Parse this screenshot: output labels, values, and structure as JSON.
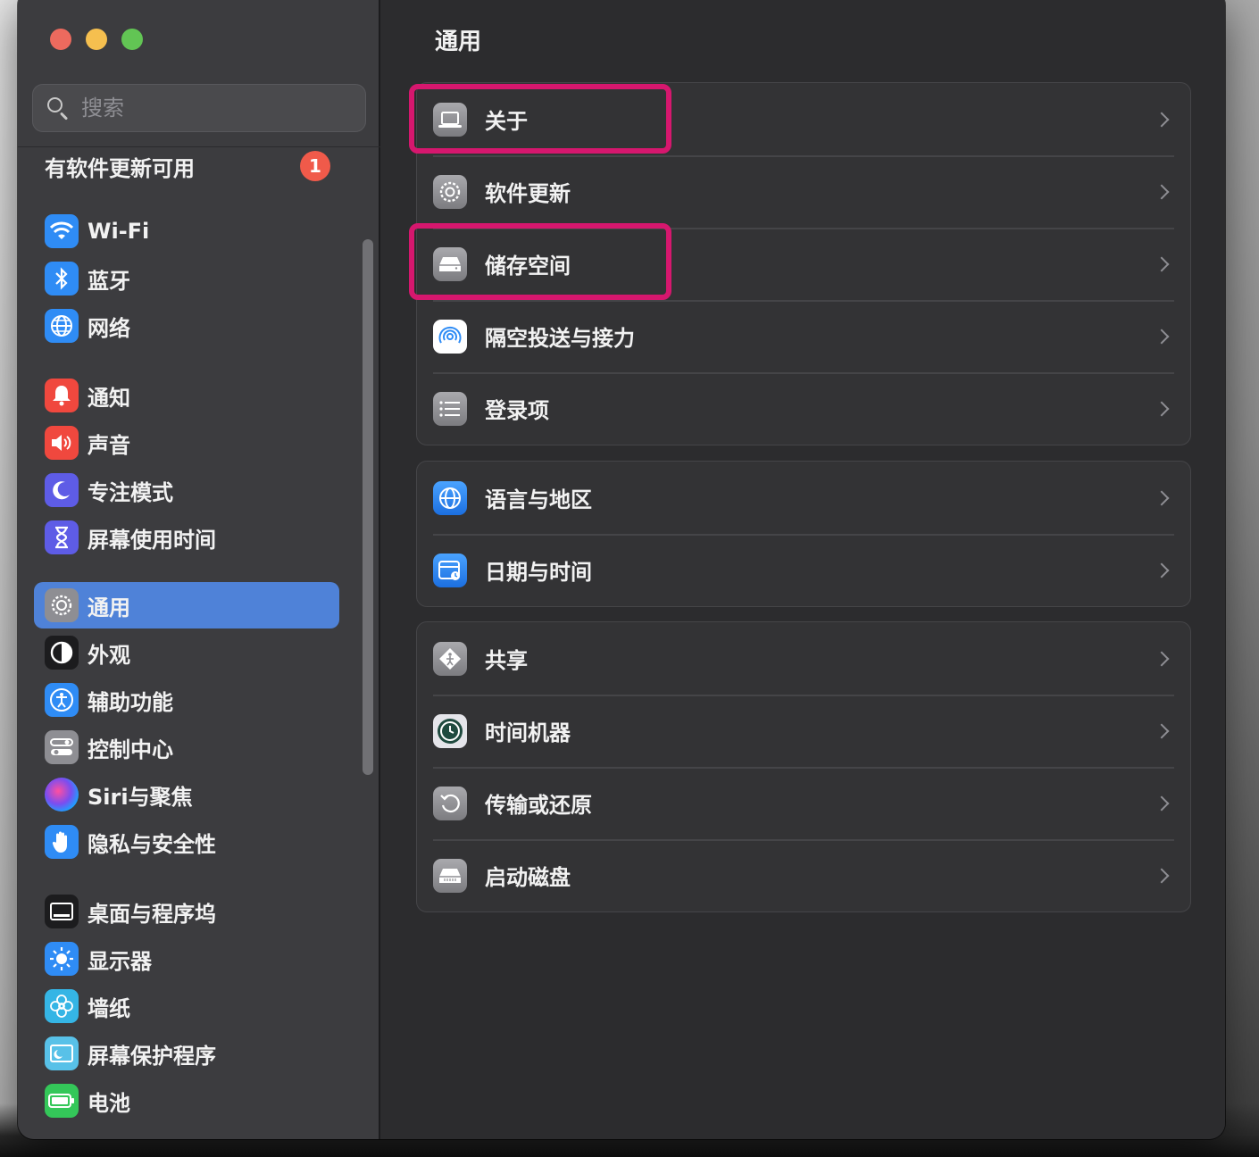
{
  "window": {
    "title": "通用"
  },
  "search": {
    "placeholder": "搜索"
  },
  "update": {
    "label": "有软件更新可用",
    "badge": "1"
  },
  "sidebar": {
    "items": [
      {
        "label": "Wi-Fi",
        "icon": "wifi-icon",
        "color": "#2f8cf5"
      },
      {
        "label": "蓝牙",
        "icon": "bluetooth-icon",
        "color": "#2f8cf5"
      },
      {
        "label": "网络",
        "icon": "globe-icon",
        "color": "#2f8cf5"
      },
      {
        "label": "通知",
        "icon": "bell-icon",
        "color": "#f0483e"
      },
      {
        "label": "声音",
        "icon": "speaker-icon",
        "color": "#f0483e"
      },
      {
        "label": "专注模式",
        "icon": "moon-icon",
        "color": "#5e5ce6"
      },
      {
        "label": "屏幕使用时间",
        "icon": "hourglass-icon",
        "color": "#5e5ce6"
      },
      {
        "label": "通用",
        "icon": "gear-icon",
        "color": "#8e8e93",
        "selected": true
      },
      {
        "label": "外观",
        "icon": "appearance-icon",
        "color": "#1c1c1e"
      },
      {
        "label": "辅助功能",
        "icon": "accessibility-icon",
        "color": "#2f8cf5"
      },
      {
        "label": "控制中心",
        "icon": "control-center-icon",
        "color": "#8e8e93"
      },
      {
        "label": "Siri与聚焦",
        "icon": "siri-icon",
        "color": "#6a3fb8"
      },
      {
        "label": "隐私与安全性",
        "icon": "hand-icon",
        "color": "#2f8cf5"
      },
      {
        "label": "桌面与程序坞",
        "icon": "dock-icon",
        "color": "#1c1c1e"
      },
      {
        "label": "显示器",
        "icon": "sun-icon",
        "color": "#2f8cf5"
      },
      {
        "label": "墙纸",
        "icon": "flower-icon",
        "color": "#35b5e5"
      },
      {
        "label": "屏幕保护程序",
        "icon": "screensaver-icon",
        "color": "#58c1e8"
      },
      {
        "label": "电池",
        "icon": "battery-icon",
        "color": "#34c759"
      }
    ]
  },
  "main": {
    "groups": [
      {
        "rows": [
          {
            "label": "关于",
            "icon": "laptop-icon"
          },
          {
            "label": "软件更新",
            "icon": "gear-badge-icon"
          },
          {
            "label": "储存空间",
            "icon": "drive-icon"
          },
          {
            "label": "隔空投送与接力",
            "icon": "airdrop-icon"
          },
          {
            "label": "登录项",
            "icon": "list-icon"
          }
        ]
      },
      {
        "rows": [
          {
            "label": "语言与地区",
            "icon": "globe-icon"
          },
          {
            "label": "日期与时间",
            "icon": "calendar-clock-icon"
          }
        ]
      },
      {
        "rows": [
          {
            "label": "共享",
            "icon": "share-icon"
          },
          {
            "label": "时间机器",
            "icon": "time-machine-icon"
          },
          {
            "label": "传输或还原",
            "icon": "restore-icon"
          },
          {
            "label": "启动磁盘",
            "icon": "startup-disk-icon"
          }
        ]
      }
    ]
  },
  "highlight_color": "#d6176e"
}
